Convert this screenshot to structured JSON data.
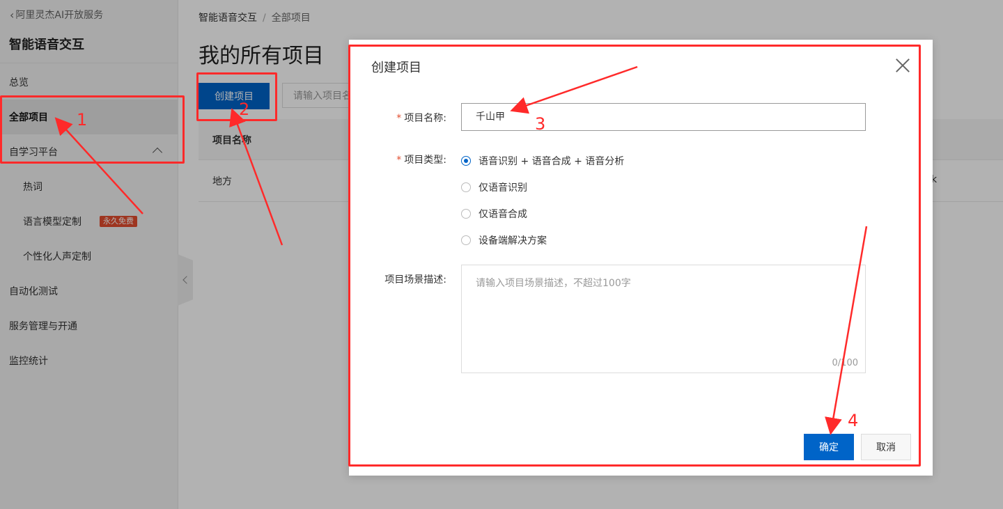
{
  "sidebar": {
    "back_label": "阿里灵杰AI开放服务",
    "title": "智能语音交互",
    "items": [
      {
        "label": "总览"
      },
      {
        "label": "全部项目"
      },
      {
        "label": "自学习平台"
      },
      {
        "label": "热词"
      },
      {
        "label": "语言模型定制",
        "badge": "永久免费"
      },
      {
        "label": "个性化人声定制"
      },
      {
        "label": "自动化测试"
      },
      {
        "label": "服务管理与开通"
      },
      {
        "label": "监控统计"
      }
    ]
  },
  "breadcrumb": {
    "root": "智能语音交互",
    "separator": "/",
    "current": "全部项目"
  },
  "main": {
    "title": "我的所有项目",
    "create_label": "创建项目",
    "search_placeholder": "请输入项目名",
    "table": {
      "header": "项目名称",
      "rows": [
        {
          "name": "地方",
          "right": "k"
        }
      ]
    }
  },
  "modal": {
    "title": "创建项目",
    "name_label": "项目名称:",
    "name_value": "千山甲",
    "type_label": "项目类型:",
    "type_options": [
      {
        "label": "语音识别 + 语音合成 + 语音分析",
        "selected": true
      },
      {
        "label": "仅语音识别",
        "selected": false
      },
      {
        "label": "仅语音合成",
        "selected": false
      },
      {
        "label": "设备端解决方案",
        "selected": false
      }
    ],
    "desc_label": "项目场景描述:",
    "desc_placeholder": "请输入项目场景描述，不超过100字",
    "desc_counter": "0/100",
    "ok_label": "确定",
    "cancel_label": "取消"
  },
  "annotations": {
    "steps": [
      "1",
      "2",
      "3",
      "4"
    ],
    "color": "#ff2a2a"
  },
  "colors": {
    "primary": "#0064c8",
    "badge": "#e24c2e",
    "annotation": "#ff2a2a"
  }
}
